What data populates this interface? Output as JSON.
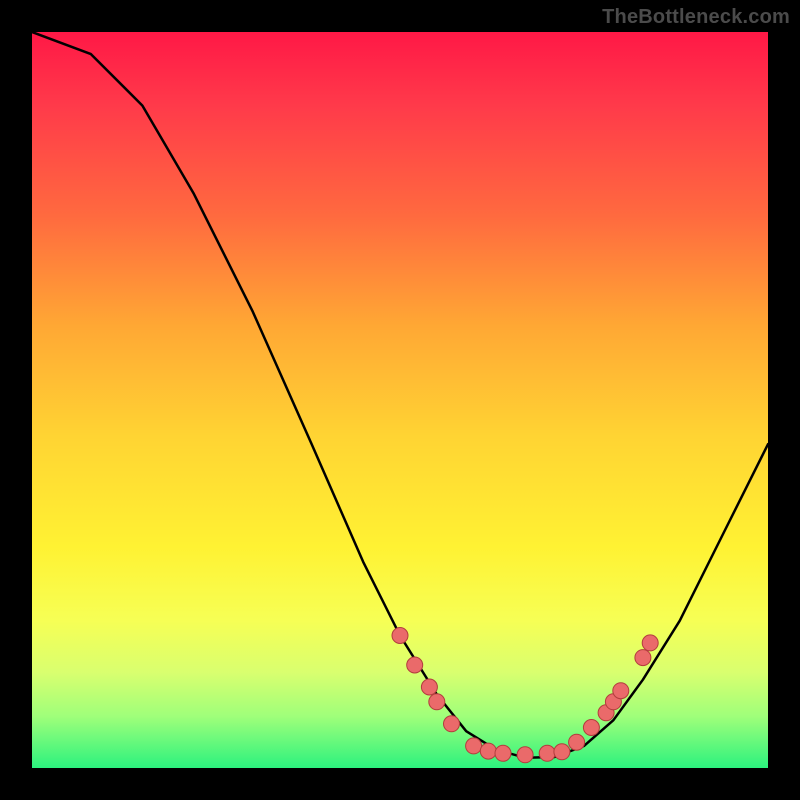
{
  "attribution": "TheBottleneck.com",
  "chart_data": {
    "type": "line",
    "title": "",
    "xlabel": "",
    "ylabel": "",
    "xlim": [
      0,
      100
    ],
    "ylim": [
      0,
      100
    ],
    "curve": [
      {
        "x": 0,
        "y": 100
      },
      {
        "x": 8,
        "y": 97
      },
      {
        "x": 15,
        "y": 90
      },
      {
        "x": 22,
        "y": 78
      },
      {
        "x": 30,
        "y": 62
      },
      {
        "x": 38,
        "y": 44
      },
      {
        "x": 45,
        "y": 28
      },
      {
        "x": 50,
        "y": 18
      },
      {
        "x": 55,
        "y": 10
      },
      {
        "x": 59,
        "y": 5
      },
      {
        "x": 63,
        "y": 2.5
      },
      {
        "x": 67,
        "y": 1.4
      },
      {
        "x": 71,
        "y": 1.5
      },
      {
        "x": 75,
        "y": 3
      },
      {
        "x": 79,
        "y": 6.5
      },
      {
        "x": 83,
        "y": 12
      },
      {
        "x": 88,
        "y": 20
      },
      {
        "x": 94,
        "y": 32
      },
      {
        "x": 100,
        "y": 44
      }
    ],
    "markers": [
      {
        "x": 50,
        "y": 18
      },
      {
        "x": 52,
        "y": 14
      },
      {
        "x": 54,
        "y": 11
      },
      {
        "x": 55,
        "y": 9
      },
      {
        "x": 57,
        "y": 6
      },
      {
        "x": 60,
        "y": 3
      },
      {
        "x": 62,
        "y": 2.3
      },
      {
        "x": 64,
        "y": 2.0
      },
      {
        "x": 67,
        "y": 1.8
      },
      {
        "x": 70,
        "y": 2.0
      },
      {
        "x": 72,
        "y": 2.2
      },
      {
        "x": 74,
        "y": 3.5
      },
      {
        "x": 76,
        "y": 5.5
      },
      {
        "x": 78,
        "y": 7.5
      },
      {
        "x": 79,
        "y": 9.0
      },
      {
        "x": 80,
        "y": 10.5
      },
      {
        "x": 83,
        "y": 15
      },
      {
        "x": 84,
        "y": 17
      }
    ],
    "marker_style": {
      "fill": "#ea6a6a",
      "stroke": "#b23d3d",
      "r": 8
    }
  }
}
